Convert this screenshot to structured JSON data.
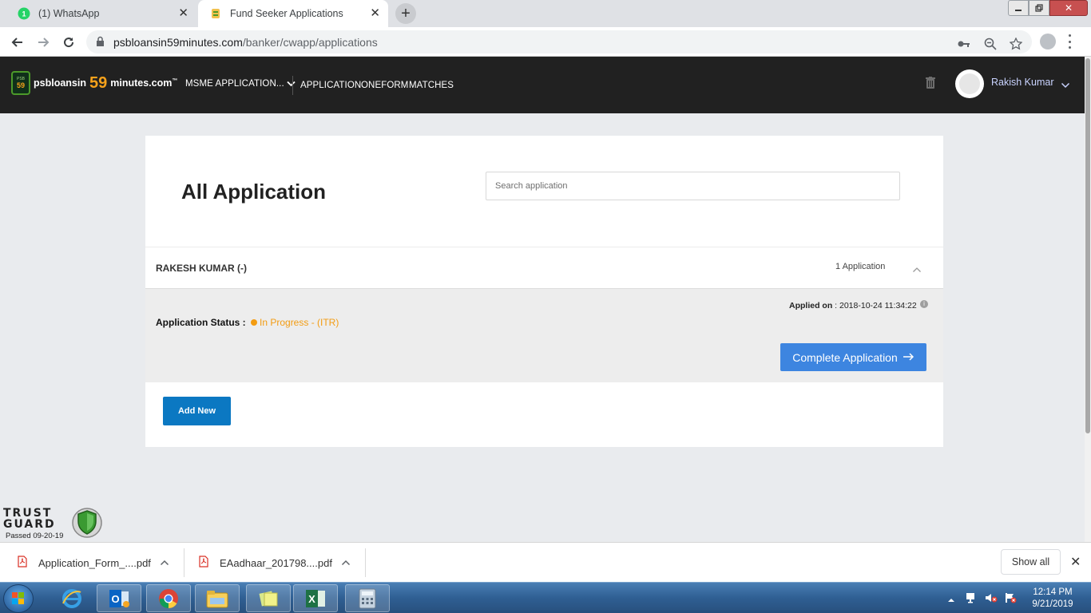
{
  "browser": {
    "tabs": [
      {
        "label": "(1) WhatsApp",
        "favicon": "whatsapp-icon",
        "active": false
      },
      {
        "label": "Fund Seeker Applications",
        "favicon": "site-icon",
        "active": true
      }
    ],
    "url_host": "psbloansin59minutes.com",
    "url_path": "/banker/cwapp/applications"
  },
  "header": {
    "logo": {
      "badge_small": "PSB",
      "badge_num": "59",
      "part1": "psbloansin",
      "part2": "59",
      "part3": "minutes.com",
      "tm": "™"
    },
    "msme_menu": "MSME APPLICATION...",
    "nav": [
      "APPLICATION",
      "ONEFORM",
      "MATCHES"
    ],
    "user_name": "Rakish Kumar"
  },
  "main": {
    "title": "All Application",
    "search_placeholder": "Search application",
    "applicant": {
      "name": "RAKESH KUMAR (-)",
      "count": "1 Application"
    },
    "application": {
      "applied_on_label": "Applied on",
      "applied_on_value": ": 2018-10-24 11:34:22",
      "status_label": "Application Status :",
      "status_value": "In Progress - (ITR)",
      "status_color": "#f39c12",
      "complete_button": "Complete Application"
    },
    "add_new_button": "Add New"
  },
  "trustguard": {
    "line1": "TRUST",
    "line2": "GUARD",
    "passed": "Passed 09-20-19"
  },
  "downloads": {
    "items": [
      "Application_Form_....pdf",
      "EAadhaar_201798....pdf"
    ],
    "show_all": "Show all"
  },
  "taskbar": {
    "apps": [
      "internet-explorer",
      "outlook",
      "chrome",
      "file-explorer",
      "sticky-notes",
      "excel",
      "calculator"
    ],
    "time": "12:14 PM",
    "date": "9/21/2019"
  },
  "colors": {
    "accent_blue": "#3d85e0",
    "add_new_blue": "#0b78c2",
    "header_bg": "#212121",
    "logo_orange": "#f7a21b"
  }
}
